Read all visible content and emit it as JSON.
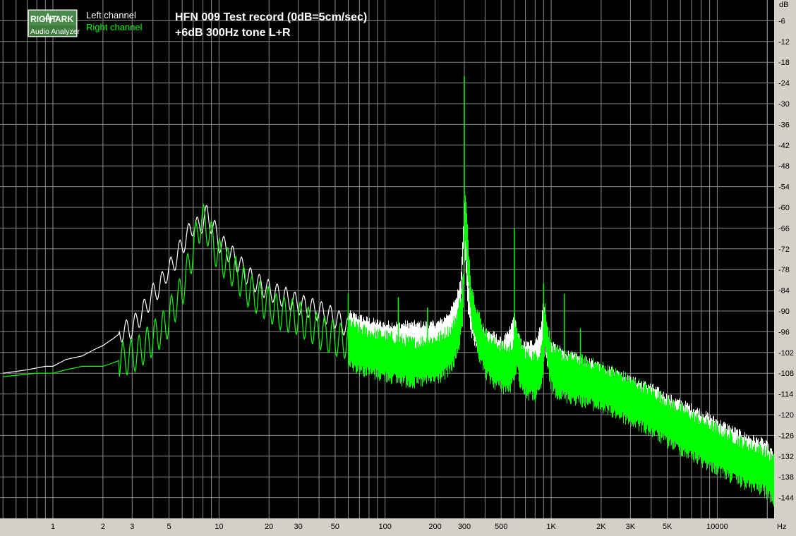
{
  "logo": {
    "top_left": "RIGHT",
    "top_right": "ARK",
    "bottom": "Audio Analyzer"
  },
  "legend": [
    {
      "label": "Left channel",
      "color": "#ffffff"
    },
    {
      "label": "Right channel",
      "color": "#00ff00"
    }
  ],
  "title_lines": [
    "HFN 009 Test record (0dB=5cm/sec)",
    "+6dB 300Hz tone L+R"
  ],
  "colors": {
    "plot_bg": "#000000",
    "grid": "#8a8a8a",
    "frame_bg": "#d4d0c8",
    "left": "#ffffff",
    "right": "#00ff00"
  },
  "chart_data": {
    "type": "line",
    "title": "HFN 009 Test record (0dB=5cm/sec)",
    "subtitle": "+6dB 300Hz tone L+R",
    "xlabel": "Hz",
    "ylabel": "dB",
    "x_scale": "log",
    "xlim": [
      0.48,
      22000
    ],
    "ylim": [
      -150,
      0
    ],
    "grid": true,
    "legend_position": "top-left",
    "x_ticks": [
      {
        "v": 1,
        "label": "1"
      },
      {
        "v": 2,
        "label": "2"
      },
      {
        "v": 3,
        "label": "3"
      },
      {
        "v": 5,
        "label": "5"
      },
      {
        "v": 10,
        "label": "10"
      },
      {
        "v": 20,
        "label": "20"
      },
      {
        "v": 30,
        "label": "30"
      },
      {
        "v": 50,
        "label": "50"
      },
      {
        "v": 100,
        "label": "100"
      },
      {
        "v": 200,
        "label": "200"
      },
      {
        "v": 300,
        "label": "300"
      },
      {
        "v": 500,
        "label": "500"
      },
      {
        "v": 1000,
        "label": "1K"
      },
      {
        "v": 2000,
        "label": "2K"
      },
      {
        "v": 3000,
        "label": "3K"
      },
      {
        "v": 5000,
        "label": "5K"
      },
      {
        "v": 10000,
        "label": "10000"
      }
    ],
    "y_ticks": [
      -6,
      -12,
      -18,
      -24,
      -30,
      -36,
      -42,
      -48,
      -54,
      -60,
      -66,
      -72,
      -78,
      -84,
      -90,
      -96,
      -102,
      -108,
      -114,
      -120,
      -126,
      -132,
      -138,
      -144
    ],
    "series": [
      {
        "name": "Left channel",
        "color": "#ffffff",
        "x": [
          0.5,
          0.7,
          0.9,
          1.0,
          1.2,
          1.5,
          1.8,
          2.0,
          2.3,
          2.6,
          3.0,
          3.3,
          3.6,
          4.0,
          4.4,
          4.8,
          5.2,
          5.6,
          6.0,
          6.5,
          7.0,
          7.5,
          8.0,
          8.5,
          9.0,
          9.5,
          10,
          11,
          12,
          13,
          14,
          15,
          17,
          20,
          22,
          25,
          30,
          35,
          40,
          45,
          50,
          60,
          70,
          80,
          100,
          120,
          150,
          200,
          220,
          250,
          270,
          285,
          295,
          300,
          305,
          315,
          330,
          360,
          400,
          450,
          500,
          550,
          580,
          600,
          620,
          650,
          700,
          800,
          850,
          880,
          900,
          920,
          950,
          1000,
          1100,
          1200,
          1500,
          2000,
          2500,
          3000,
          4000,
          5000,
          7000,
          10000,
          13000,
          16000,
          19000,
          20000,
          22000
        ],
        "y": [
          -108,
          -107,
          -106,
          -106,
          -104,
          -103,
          -101,
          -100,
          -98,
          -96,
          -95,
          -92,
          -89,
          -85,
          -83,
          -79,
          -77,
          -74,
          -71,
          -68,
          -65,
          -66,
          -64,
          -62,
          -65,
          -67,
          -70,
          -72,
          -74,
          -76,
          -78,
          -80,
          -82,
          -84,
          -85,
          -86,
          -88,
          -89,
          -90,
          -91,
          -92,
          -95,
          -96,
          -97,
          -98,
          -98,
          -98,
          -98,
          -97,
          -94,
          -90,
          -85,
          -70,
          -60,
          -72,
          -85,
          -92,
          -97,
          -100,
          -101,
          -103,
          -101,
          -98,
          -95,
          -100,
          -103,
          -104,
          -103,
          -100,
          -96,
          -90,
          -96,
          -102,
          -104,
          -105,
          -106,
          -108,
          -110,
          -112,
          -114,
          -116,
          -119,
          -122,
          -126,
          -129,
          -131,
          -132,
          -133,
          -136
        ]
      },
      {
        "name": "Right channel",
        "color": "#00ff00",
        "x": [
          0.5,
          0.8,
          1.0,
          1.2,
          1.5,
          1.8,
          2.0,
          2.3,
          2.6,
          3.0,
          3.3,
          3.6,
          4.0,
          4.4,
          4.8,
          5.2,
          5.6,
          6.0,
          6.5,
          7.0,
          7.5,
          8.0,
          8.5,
          9.0,
          9.5,
          10,
          11,
          12,
          13,
          14,
          15,
          17,
          20,
          22,
          25,
          30,
          35,
          40,
          45,
          50,
          60,
          70,
          80,
          100,
          120,
          150,
          200,
          220,
          250,
          270,
          285,
          295,
          300,
          305,
          315,
          330,
          360,
          400,
          450,
          500,
          550,
          580,
          600,
          620,
          650,
          700,
          800,
          850,
          880,
          900,
          920,
          950,
          1000,
          1100,
          1200,
          1500,
          2000,
          2500,
          3000,
          4000,
          5000,
          7000,
          10000,
          13000,
          16000,
          19000,
          20000,
          22000
        ],
        "y": [
          -109,
          -108,
          -108,
          -107,
          -106,
          -106,
          -106,
          -105,
          -104,
          -103,
          -102,
          -100,
          -98,
          -96,
          -94,
          -90,
          -87,
          -84,
          -78,
          -72,
          -66,
          -64,
          -66,
          -69,
          -72,
          -74,
          -76,
          -78,
          -80,
          -82,
          -84,
          -86,
          -88,
          -90,
          -91,
          -92,
          -94,
          -96,
          -97,
          -98,
          -99,
          -101,
          -102,
          -103,
          -104,
          -105,
          -104,
          -103,
          -101,
          -97,
          -92,
          -86,
          -72,
          -62,
          -74,
          -88,
          -96,
          -102,
          -105,
          -106,
          -107,
          -106,
          -103,
          -100,
          -105,
          -108,
          -109,
          -108,
          -105,
          -100,
          -94,
          -100,
          -106,
          -108,
          -109,
          -110,
          -112,
          -114,
          -116,
          -119,
          -122,
          -126,
          -130,
          -133,
          -135,
          -136,
          -137,
          -139
        ]
      }
    ],
    "spikes": [
      {
        "x": 300,
        "y": -22,
        "series": "Right channel"
      },
      {
        "x": 600,
        "y": -66,
        "series": "Right channel"
      },
      {
        "x": 900,
        "y": -82,
        "series": "Right channel"
      },
      {
        "x": 1200,
        "y": -85,
        "series": "Right channel"
      },
      {
        "x": 1500,
        "y": -95,
        "series": "Right channel"
      },
      {
        "x": 60,
        "y": -85,
        "series": "Right channel"
      },
      {
        "x": 120,
        "y": -86,
        "series": "Right channel"
      },
      {
        "x": 180,
        "y": -89,
        "series": "Right channel"
      }
    ]
  }
}
